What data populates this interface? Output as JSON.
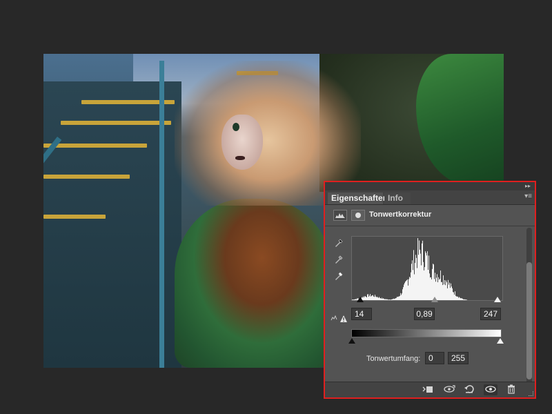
{
  "panel": {
    "tabs": [
      {
        "label": "Eigenschaften",
        "active": true
      },
      {
        "label": "Info",
        "active": false
      }
    ],
    "adjustment_title": "Tonwertkorrektur",
    "input_levels": {
      "black": "14",
      "gamma": "0,89",
      "white": "247"
    },
    "output_levels": {
      "label": "Tonwertumfang:",
      "black": "0",
      "white": "255"
    },
    "accent_color": "#e01f1f",
    "icons": [
      "histogram-icon",
      "mask-icon",
      "black-eyedropper-icon",
      "gray-eyedropper-icon",
      "white-eyedropper-icon",
      "clipping-warning-icon",
      "clip-to-layer-icon",
      "view-previous-state-icon",
      "reset-icon",
      "visibility-icon",
      "trash-icon"
    ]
  }
}
